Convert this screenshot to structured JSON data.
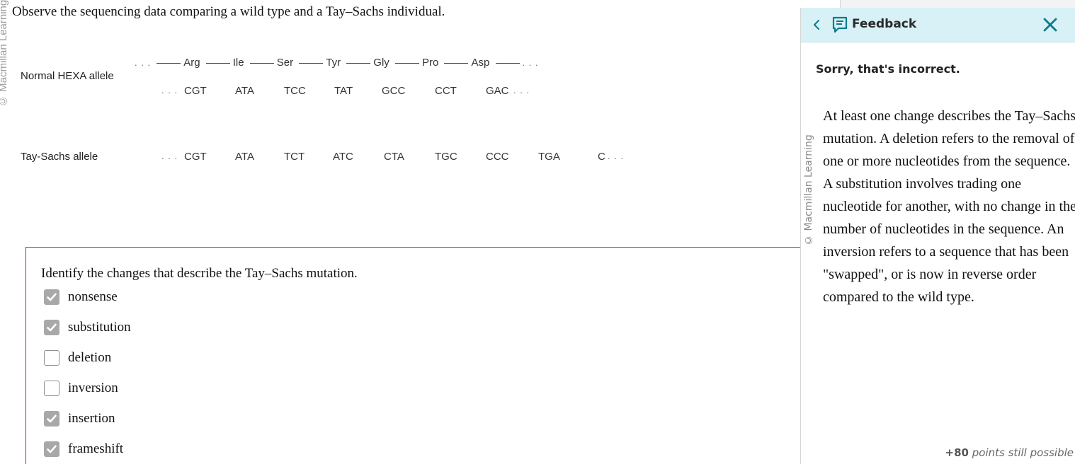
{
  "left_credit": "© Macmillan Learning",
  "question": {
    "intro": "Observe the sequencing data comparing a wild type and a Tay–Sachs individual."
  },
  "figure": {
    "normal_label": "Normal HEXA allele",
    "tay_label": "Tay-Sachs allele",
    "leading_dots": ". . .",
    "trailing_dots": ". . .",
    "amino_acids": [
      "Arg",
      "Ile",
      "Ser",
      "Tyr",
      "Gly",
      "Pro",
      "Asp"
    ],
    "normal_codons": [
      "CGT",
      "ATA",
      "TCC",
      "TAT",
      "GCC",
      "CCT",
      "GAC"
    ],
    "tay_codons": [
      "CGT",
      "ATA",
      "TCT",
      "ATC",
      "CTA",
      "TGC",
      "CCC",
      "TGA",
      "C"
    ]
  },
  "choices": {
    "prompt": "Identify the changes that describe the Tay–Sachs mutation.",
    "options": [
      {
        "label": "nonsense",
        "checked": true
      },
      {
        "label": "substitution",
        "checked": true
      },
      {
        "label": "deletion",
        "checked": false
      },
      {
        "label": "inversion",
        "checked": false
      },
      {
        "label": "insertion",
        "checked": true
      },
      {
        "label": "frameshift",
        "checked": true
      }
    ]
  },
  "feedback_panel": {
    "title": "Feedback",
    "back_icon": "chevron-left-icon",
    "title_icon": "feedback-icon",
    "close_icon": "close-icon",
    "verdict": "Sorry, that's incorrect.",
    "credit": "© Macmillan Learning",
    "body": "At least one change describes the Tay–Sachs mutation. A deletion refers to the removal of one or more nucleotides from the sequence. A substitution involves trading one nucleotide for another, with no change in the number of nucleotides in the sequence. An inversion refers to a sequence that has been \"swapped\", or is now in reverse order compared to the wild type.",
    "points_value": "+80",
    "points_text": "points still possible",
    "header_color": "#d7f1f6",
    "accent_color": "#0a7b8c"
  },
  "colors": {
    "question_border": "#c8202a",
    "checkbox_checked": "#a8a8a8"
  }
}
